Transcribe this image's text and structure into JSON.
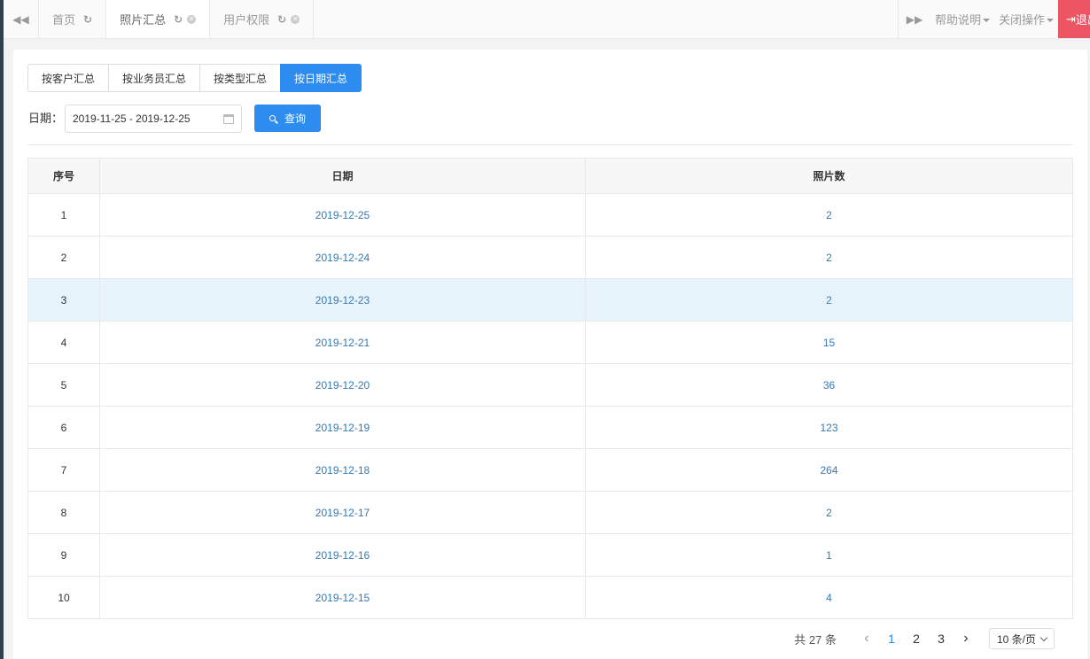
{
  "tabbar": {
    "back_icon": "double-left-arrow-icon",
    "tabs": [
      {
        "label": "首页",
        "refresh_icon": "↻",
        "close_icon": ""
      },
      {
        "label": "照片汇总",
        "refresh_icon": "↻",
        "close_icon": "✕"
      },
      {
        "label": "用户权限",
        "refresh_icon": "↻",
        "close_icon": "✕"
      }
    ],
    "forward_icon": "double-right-arrow-icon",
    "help_label": "帮助说明",
    "close_ops_label": "关闭操作",
    "logout_label": "退出"
  },
  "summary_buttons": [
    "按客户汇总",
    "按业务员汇总",
    "按类型汇总",
    "按日期汇总"
  ],
  "filter": {
    "date_label": "日期：",
    "date_range": "2019-11-25 - 2019-12-25",
    "search_label": "查询"
  },
  "table": {
    "headers": [
      "序号",
      "日期",
      "照片数"
    ],
    "rows": [
      {
        "no": "1",
        "date": "2019-12-25",
        "count": "2"
      },
      {
        "no": "2",
        "date": "2019-12-24",
        "count": "2"
      },
      {
        "no": "3",
        "date": "2019-12-23",
        "count": "2"
      },
      {
        "no": "4",
        "date": "2019-12-21",
        "count": "15"
      },
      {
        "no": "5",
        "date": "2019-12-20",
        "count": "36"
      },
      {
        "no": "6",
        "date": "2019-12-19",
        "count": "123"
      },
      {
        "no": "7",
        "date": "2019-12-18",
        "count": "264"
      },
      {
        "no": "8",
        "date": "2019-12-17",
        "count": "2"
      },
      {
        "no": "9",
        "date": "2019-12-16",
        "count": "1"
      },
      {
        "no": "10",
        "date": "2019-12-15",
        "count": "4"
      }
    ]
  },
  "pager": {
    "total": "共 27 条",
    "prev": "‹",
    "pages": [
      "1",
      "2",
      "3"
    ],
    "next": "›",
    "page_size": "10 条/页"
  },
  "colors": {
    "accent": "#2d8cf0",
    "link": "#337ab7",
    "logout": "#ed5565",
    "row_highlight": "#e8f4fc"
  }
}
